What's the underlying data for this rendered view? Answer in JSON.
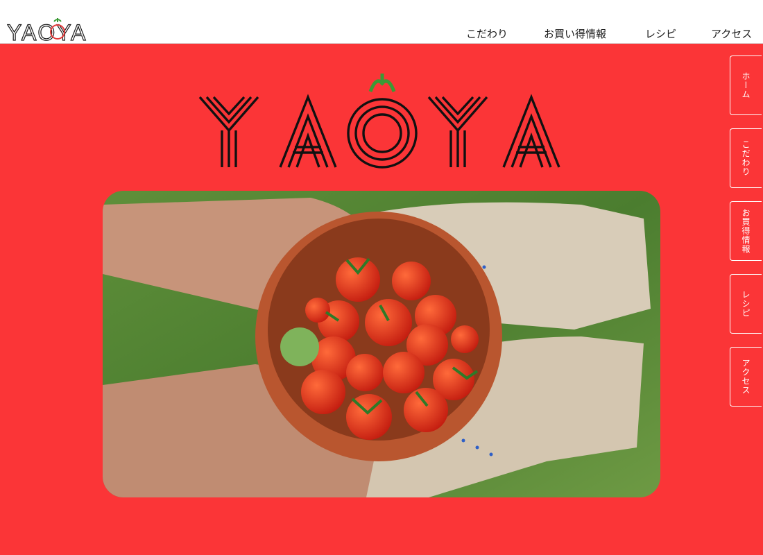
{
  "brand": {
    "logo_text": "YAOYA"
  },
  "header": {
    "nav": [
      {
        "label": "こだわり"
      },
      {
        "label": "お買い得情報"
      },
      {
        "label": "レシピ"
      },
      {
        "label": "アクセス"
      }
    ]
  },
  "side_nav": [
    {
      "label": "ホーム"
    },
    {
      "label": "こだわり"
    },
    {
      "label": "お買得情報"
    },
    {
      "label": "レシピ"
    },
    {
      "label": "アクセス"
    }
  ],
  "colors": {
    "brand_red": "#fb3537",
    "header_bg": "#ffffff",
    "logo_dark": "#1a1a1a",
    "leaf_green": "#3a9a35"
  },
  "hero": {
    "image": "hands-with-tomato-bowl-photo"
  }
}
